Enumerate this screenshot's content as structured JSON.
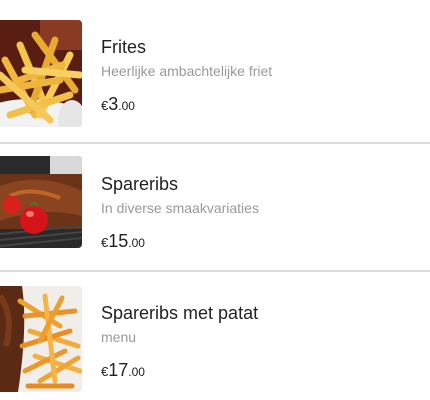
{
  "items": [
    {
      "name": "Frites",
      "description": "Heerlijke ambachtelijke friet",
      "currency": "€",
      "price_whole": "3",
      "price_cents": ".00",
      "image": "fries-photo"
    },
    {
      "name": "Spareribs",
      "description": "In diverse smaakvariaties",
      "currency": "€",
      "price_whole": "15",
      "price_cents": ".00",
      "image": "spareribs-photo"
    },
    {
      "name": "Spareribs met patat",
      "description": "menu",
      "currency": "€",
      "price_whole": "17",
      "price_cents": ".00",
      "image": "spareribs-with-fries-photo"
    }
  ],
  "colors": {
    "title": "#222222",
    "description": "#999999",
    "divider": "#dddddd"
  }
}
